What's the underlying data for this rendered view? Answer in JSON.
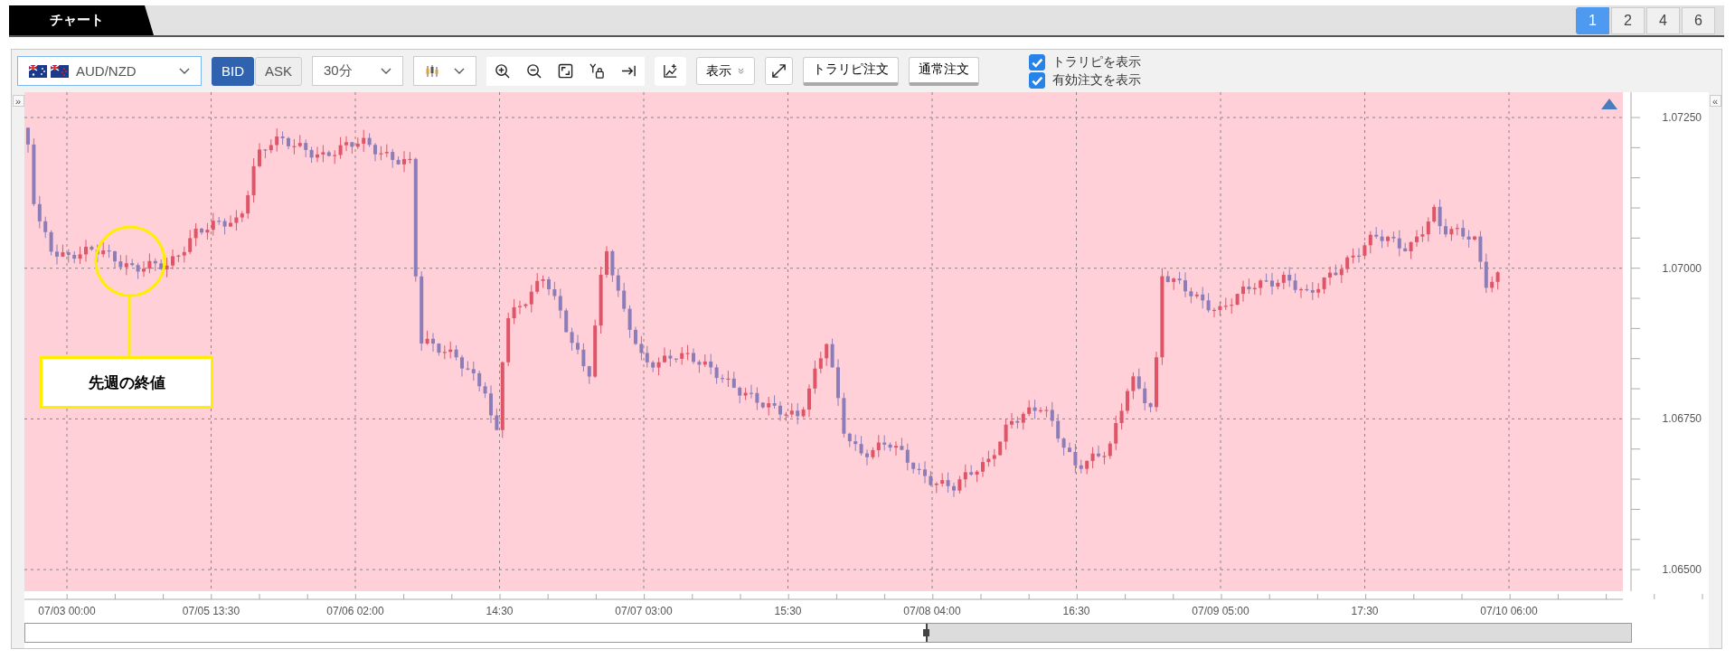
{
  "header": {
    "title": "チャート",
    "layouts": [
      {
        "label": "1",
        "selected": true
      },
      {
        "label": "2",
        "selected": false
      },
      {
        "label": "4",
        "selected": false
      },
      {
        "label": "6",
        "selected": false
      }
    ]
  },
  "toolbar": {
    "pair": "AUD/NZD",
    "price_sides": [
      {
        "label": "BID",
        "selected": true
      },
      {
        "label": "ASK",
        "selected": false
      }
    ],
    "timeframe": "30分",
    "view_menu": "表示",
    "order_buttons": [
      "トラリピ注文",
      "通常注文"
    ],
    "checkboxes": [
      {
        "label": "トラリピを表示",
        "checked": true
      },
      {
        "label": "有効注文を表示",
        "checked": true
      }
    ]
  },
  "chart": {
    "expand_left": "»",
    "collapse_right": "«",
    "annotation": "先週の終値",
    "y_axis_labels": [
      "1.07250",
      "1.07000",
      "1.06750",
      "1.06500"
    ],
    "x_axis_labels": [
      "07/03 00:00",
      "07/05 13:30",
      "07/06 02:00",
      "14:30",
      "07/07 03:00",
      "15:30",
      "07/08 04:00",
      "16:30",
      "07/09 05:00",
      "17:30",
      "07/10 06:00"
    ]
  }
}
